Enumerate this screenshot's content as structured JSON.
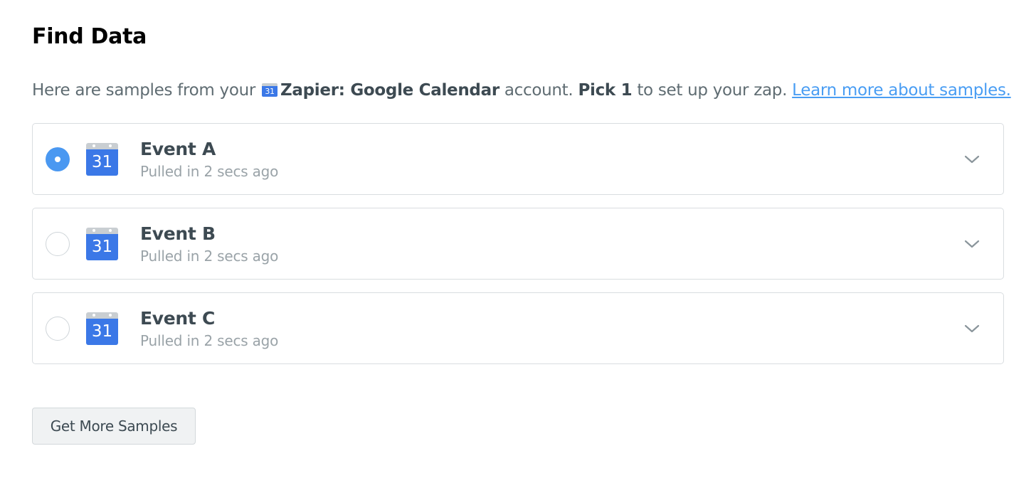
{
  "header": {
    "title": "Find Data"
  },
  "intro": {
    "prefix": "Here are samples from your ",
    "app_icon": "google-calendar-icon",
    "app_icon_day": "31",
    "account_name": "Zapier: Google Calendar",
    "middle": " account. ",
    "pick": "Pick 1",
    "suffix": " to set up your zap. ",
    "link_text": "Learn more about samples."
  },
  "samples": [
    {
      "title": "Event A",
      "subtitle": "Pulled in 2 secs ago",
      "selected": true,
      "icon": "google-calendar-icon",
      "day": "31"
    },
    {
      "title": "Event B",
      "subtitle": "Pulled in 2 secs ago",
      "selected": false,
      "icon": "google-calendar-icon",
      "day": "31"
    },
    {
      "title": "Event C",
      "subtitle": "Pulled in 2 secs ago",
      "selected": false,
      "icon": "google-calendar-icon",
      "day": "31"
    }
  ],
  "actions": {
    "get_more_label": "Get More Samples"
  },
  "colors": {
    "accent": "#4a98f1",
    "link": "#499df3",
    "calendar_blue": "#3b78e7",
    "border": "#d9dde0"
  }
}
